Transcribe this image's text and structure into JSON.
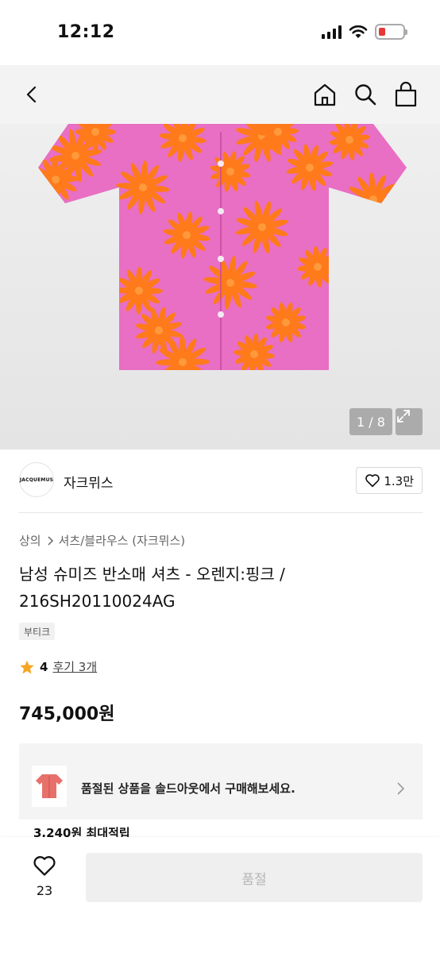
{
  "status_bar": {
    "time": "12:12"
  },
  "colors": {
    "shirt": "#e86fc3",
    "petal": "#ff7a1a",
    "battery_low": "#e53935",
    "star": "#f5a623"
  },
  "nav": {
    "back_icon": "chevron-left-icon",
    "home_icon": "home-icon",
    "search_icon": "search-icon",
    "cart_icon": "shopping-bag-icon"
  },
  "gallery": {
    "counter": "1 / 8",
    "current": 1,
    "total": 8
  },
  "brand": {
    "logo_text": "JACQUEMUS",
    "name": "자크뮈스",
    "likes": "1.3만"
  },
  "breadcrumb": {
    "level1": "상의",
    "level2": "셔츠/블라우스 (자크뮈스)"
  },
  "product": {
    "title": "남성 슈미즈 반소매 셔츠 - 오렌지:핑크 / 216SH20110024AG",
    "tag": "부티크",
    "rating": "4",
    "review_label": "후기 3개",
    "price": "745,000원"
  },
  "soldout": {
    "message": "품절된 상품을 솔드아웃에서 구매해보세요.",
    "points": "3,240원 최대적립"
  },
  "bottom": {
    "wish_count": "23",
    "buy_label": "품절"
  }
}
